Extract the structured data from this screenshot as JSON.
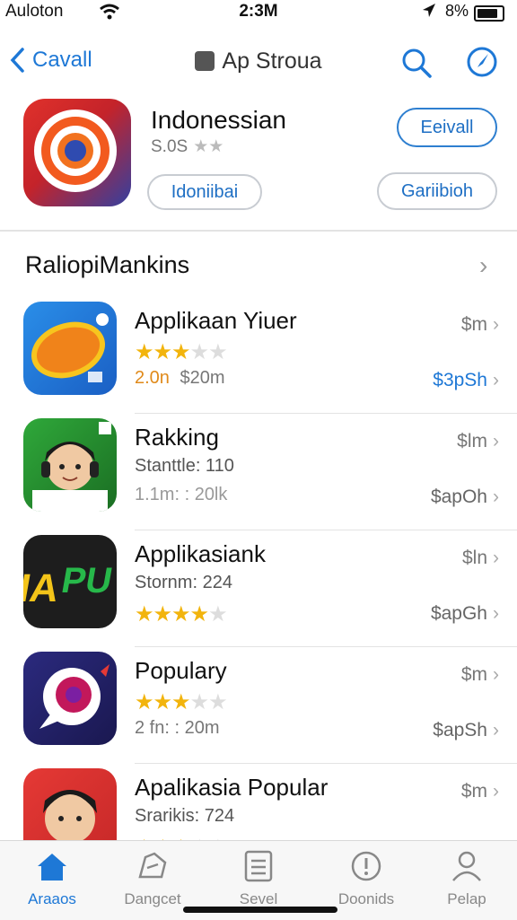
{
  "status": {
    "carrier": "Auloton",
    "time": "2:3M",
    "battery": "8%"
  },
  "nav": {
    "back_label": "Cavall",
    "title": "Ap Stroua"
  },
  "hero": {
    "name": "Indonessian",
    "subtitle": "S.0S",
    "stars": "★★",
    "get_label": "Eeivall",
    "tag_label": "Idoniibai",
    "gallery_label": "Gariibioh"
  },
  "section": {
    "title": "RaliopiMankins"
  },
  "rows": [
    {
      "name": "Applikaan Yiuer",
      "line2": "★★★",
      "line3_a": "2.0n",
      "line3_b": "$20m",
      "price1": "$m",
      "price2": "$3pSh"
    },
    {
      "name": "Rakking",
      "line2": "Stanttle: 110",
      "line3": "1.1m: : 20lk",
      "price1": "$lm",
      "price2": "$apOh"
    },
    {
      "name": "Applikasiank",
      "line2": "Stornm: 224",
      "line3": "★★★★",
      "price1": "$ln",
      "price2": "$apGh"
    },
    {
      "name": "Populary",
      "line2": "★★★",
      "line3": "2 fn: : 20m",
      "price1": "$m",
      "price2": "$apSh"
    },
    {
      "name": "Apalikasia Popular",
      "line2": "Srarikis: 724",
      "line3": "★★★",
      "price1": "$m",
      "price2": ""
    }
  ],
  "tabs": [
    {
      "label": "Araaos",
      "icon": "home-icon",
      "active": true
    },
    {
      "label": "Dangcet",
      "icon": "games-icon"
    },
    {
      "label": "Sevel",
      "icon": "list-icon"
    },
    {
      "label": "Doonids",
      "icon": "alert-icon"
    },
    {
      "label": "Pelap",
      "icon": "person-icon"
    }
  ],
  "colors": {
    "accent": "#1e78d6",
    "star": "#f2b40d"
  }
}
